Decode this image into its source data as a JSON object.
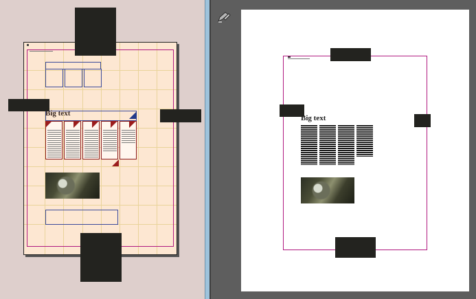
{
  "layout_view": {
    "headline": "Big text"
  },
  "preview": {
    "headline": "Big text"
  },
  "toolbar": {
    "edit_icon": "pencil-icon"
  },
  "colors": {
    "layout_background": "#decfcc",
    "page_fill": "#fde7d2",
    "margin_guide": "#b0187f",
    "frame_blue": "#3a4a9a",
    "frame_red": "#8b1a1a",
    "splitter": "#9ec3dc",
    "preview_background": "#5e5e5e",
    "preview_page": "#ffffff"
  }
}
